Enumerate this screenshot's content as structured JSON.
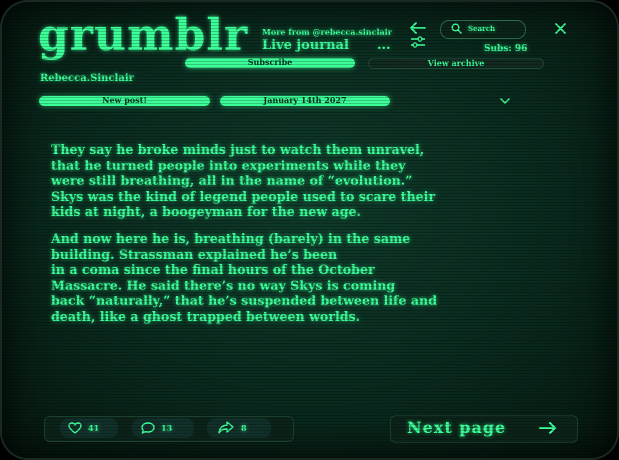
{
  "header": {
    "logo": "grumblr",
    "more_from": "More from @rebecca.sinclair",
    "live_journal": "Live journal",
    "more_dots": "...",
    "search_placeholder": "Search",
    "subs": "Subs: 96",
    "subscribe": "Subscribe",
    "view_archive": "View archive"
  },
  "author": "Rebecca.Sinclair",
  "toolbar": {
    "new_post": "New post!",
    "date": "January 14th 2027"
  },
  "post": {
    "paragraphs": [
      "They  say he broke minds just to watch them unravel,\nthat he turned people into experiments while they\nwere still breathing, all in the name of “evolution.”\nSkys was the kind of legend people used to scare their\nkids at night, a boogeyman for the new age.",
      "And now here he is, breathing (barely) in the same\nbuilding. Strassman explained he’s been\nin a coma since the final hours of the October\nMassacre. He said there’s no way Skys is coming\nback “naturally,” that he’s suspended between life and\ndeath, like a ghost trapped between worlds."
    ]
  },
  "footer": {
    "likes": "41",
    "comments": "13",
    "shares": "8",
    "next_page": "Next page"
  },
  "colors": {
    "accent": "#3dff9a",
    "background": "#0a2a1e",
    "pill_text": "#063220"
  }
}
